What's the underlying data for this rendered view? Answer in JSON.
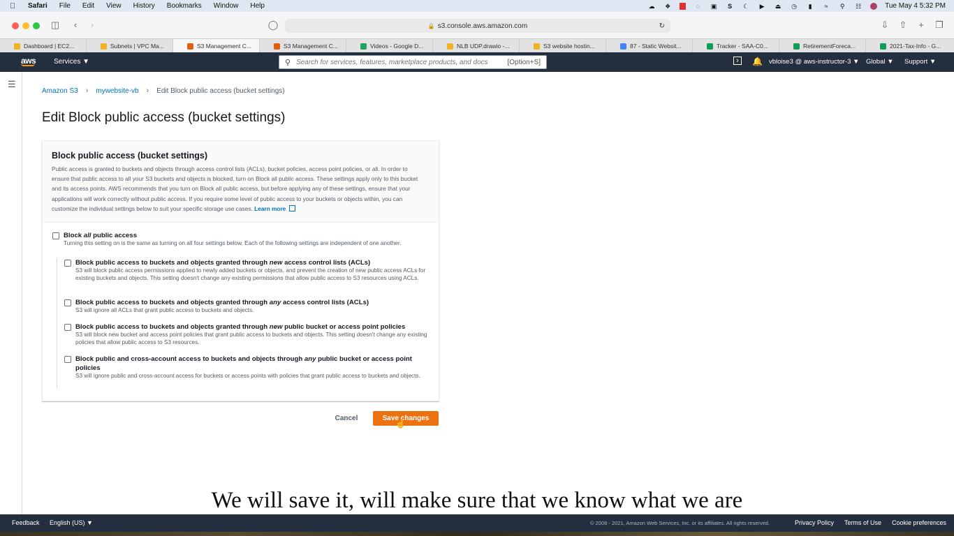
{
  "menubar": {
    "app": "Safari",
    "items": [
      "File",
      "Edit",
      "View",
      "History",
      "Bookmarks",
      "Window",
      "Help"
    ],
    "datetime": "Tue May 4  5:32 PM"
  },
  "browser": {
    "url": "s3.console.aws.amazon.com",
    "tabs": [
      {
        "label": "Dashboard | EC2...",
        "color": "#f0b323"
      },
      {
        "label": "Subnets | VPC Ma...",
        "color": "#f0b323"
      },
      {
        "label": "S3 Management C...",
        "color": "#e25d10"
      },
      {
        "label": "S3 Management C...",
        "color": "#e25d10"
      },
      {
        "label": "Videos - Google D...",
        "color": "#1fa463"
      },
      {
        "label": "NLB UDP.drawio -...",
        "color": "#f0b323"
      },
      {
        "label": "S3 website hostin...",
        "color": "#f0b323"
      },
      {
        "label": "87 - Static Websit...",
        "color": "#4285f4"
      },
      {
        "label": "Tracker - SAA-C0...",
        "color": "#0f9d58"
      },
      {
        "label": "RetirementForeca...",
        "color": "#0f9d58"
      },
      {
        "label": "2021-Tax-Info - G...",
        "color": "#0f9d58"
      }
    ]
  },
  "aws_nav": {
    "logo": "aws",
    "services": "Services ▼",
    "search_placeholder": "Search for services, features, marketplace products, and docs",
    "search_shortcut": "[Option+S]",
    "account": "vbloise3 @ aws-instructor-3 ▼",
    "region": "Global ▼",
    "support": "Support ▼"
  },
  "breadcrumb": {
    "root": "Amazon S3",
    "bucket": "mywebsite-vb",
    "current": "Edit Block public access (bucket settings)"
  },
  "page": {
    "title": "Edit Block public access (bucket settings)"
  },
  "panel": {
    "title": "Block public access (bucket settings)",
    "description": "Public access is granted to buckets and objects through access control lists (ACLs), bucket policies, access point policies, or all. In order to ensure that public access to all your S3 buckets and objects is blocked, turn on Block all public access. These settings apply only to this bucket and its access points. AWS recommends that you turn on Block all public access, but before applying any of these settings, ensure that your applications will work correctly without public access. If you require some level of public access to your buckets or objects within, you can customize the individual settings below to suit your specific storage use cases.",
    "learn_more": "Learn more",
    "block_all": {
      "pre": "Block ",
      "em": "all",
      "post": " public access",
      "desc": "Turning this setting on is the same as turning on all four settings below. Each of the following settings are independent of one another.",
      "checked": false
    },
    "options": [
      {
        "pre": "Block public access to buckets and objects granted through ",
        "em": "new",
        "post": " access control lists (ACLs)",
        "desc": "S3 will block public access permissions applied to newly added buckets or objects, and prevent the creation of new public access ACLs for existing buckets and objects. This setting doesn't change any existing permissions that allow public access to S3 resources using ACLs.",
        "checked": false
      },
      {
        "pre": "Block public access to buckets and objects granted through ",
        "em": "any",
        "post": " access control lists (ACLs)",
        "desc": "S3 will ignore all ACLs that grant public access to buckets and objects.",
        "checked": false
      },
      {
        "pre": "Block public access to buckets and objects granted through ",
        "em": "new",
        "post": " public bucket or access point policies",
        "desc": "S3 will block new bucket and access point policies that grant public access to buckets and objects. This setting doesn't change any existing policies that allow public access to S3 resources.",
        "checked": false
      },
      {
        "pre": "Block public and cross-account access to buckets and objects through ",
        "em": "any",
        "post": " public bucket or access point policies",
        "desc": "S3 will ignore public and cross-account access for buckets or access points with policies that grant public access to buckets and objects.",
        "checked": false
      }
    ]
  },
  "actions": {
    "cancel": "Cancel",
    "save": "Save changes"
  },
  "caption": "We will save it, will make sure that we know what we are",
  "footer": {
    "feedback": "Feedback",
    "language": "English (US) ▼",
    "copyright": "© 2008 - 2021, Amazon Web Services, Inc. or its affiliates. All rights reserved.",
    "privacy": "Privacy Policy",
    "terms": "Terms of Use",
    "cookies": "Cookie preferences"
  },
  "colors": {
    "aws_nav": "#232f3e",
    "primary_button": "#ec7211",
    "link": "#0073bb"
  }
}
